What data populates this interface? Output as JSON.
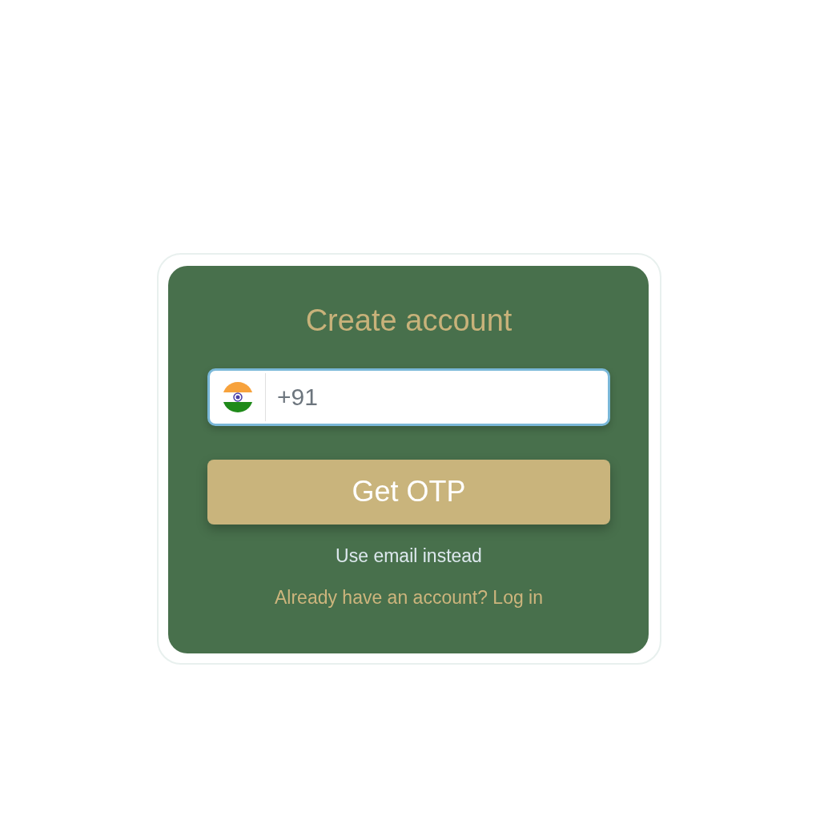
{
  "title": "Create account",
  "phone_field": {
    "placeholder": "+91"
  },
  "buttons": [
    {
      "label": "Get OTP"
    }
  ],
  "links": [
    {
      "kind": "alternate",
      "label": "Use email instead"
    },
    {
      "kind": "login",
      "label": "Already have an account? Log in"
    }
  ]
}
